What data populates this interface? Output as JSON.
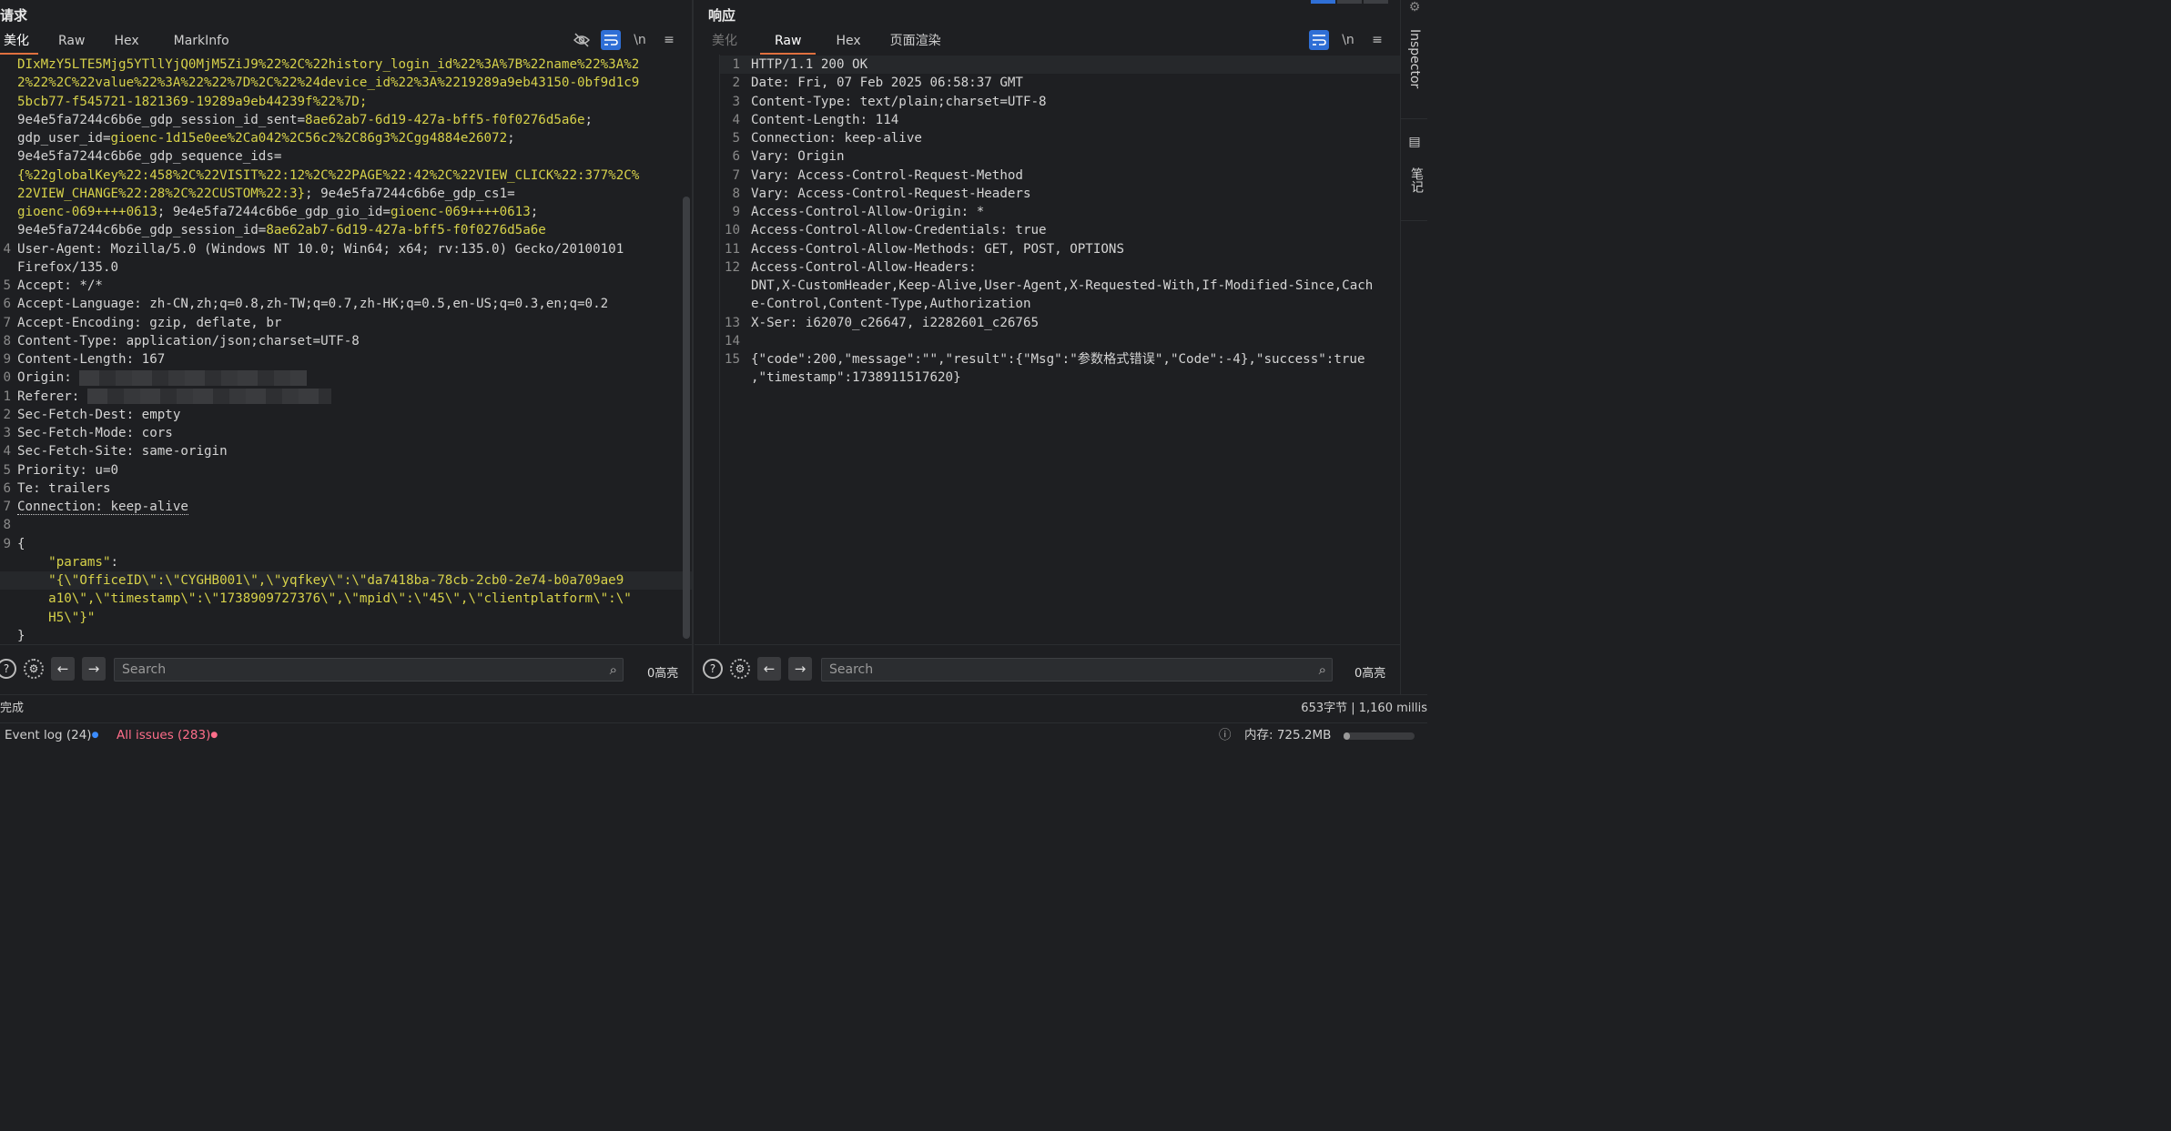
{
  "request": {
    "title": "请求",
    "tabs": [
      "美化",
      "Raw",
      "Hex",
      "MarkInfo"
    ],
    "lines": [
      {
        "n": "",
        "parts": [
          [
            "ck",
            "DIxMzY5LTE5Mjg5YTllYjQ0MjM5ZiJ9%22%2C%22history_login_id%22%3A%7B%22name%22%3A%2"
          ]
        ]
      },
      {
        "n": "",
        "parts": [
          [
            "ck",
            "2%22%2C%22value%22%3A%22%22%7D%2C%22%24device_id%22%3A%2219289a9eb43150-0bf9d1c9"
          ]
        ]
      },
      {
        "n": "",
        "parts": [
          [
            "ck",
            "5bcb77-f545721-1821369-19289a9eb44239f%22%7D;"
          ]
        ]
      },
      {
        "n": "",
        "parts": [
          [
            "hk",
            "9e4e5fa7244c6b6e_gdp_session_id_sent="
          ],
          [
            "ck",
            "8ae62ab7-6d19-427a-bff5-f0f0276d5a6e"
          ],
          [
            "hk",
            ";"
          ]
        ]
      },
      {
        "n": "",
        "parts": [
          [
            "hk",
            "gdp_user_id="
          ],
          [
            "ck",
            "gioenc-1d15e0ee%2Ca042%2C56c2%2C86g3%2Cgg4884e26072"
          ],
          [
            "hk",
            ";"
          ]
        ]
      },
      {
        "n": "",
        "parts": [
          [
            "hk",
            "9e4e5fa7244c6b6e_gdp_sequence_ids="
          ]
        ]
      },
      {
        "n": "",
        "parts": [
          [
            "ck",
            "{%22globalKey%22:458%2C%22VISIT%22:12%2C%22PAGE%22:42%2C%22VIEW_CLICK%22:377%2C%"
          ]
        ]
      },
      {
        "n": "",
        "parts": [
          [
            "ck",
            "22VIEW_CHANGE%22:28%2C%22CUSTOM%22:3}"
          ],
          [
            "hk",
            "; 9e4e5fa7244c6b6e_gdp_cs1="
          ]
        ]
      },
      {
        "n": "",
        "parts": [
          [
            "ck",
            "gioenc-069++++0613"
          ],
          [
            "hk",
            "; 9e4e5fa7244c6b6e_gdp_gio_id="
          ],
          [
            "ck",
            "gioenc-069++++0613"
          ],
          [
            "hk",
            ";"
          ]
        ]
      },
      {
        "n": "",
        "parts": [
          [
            "hk",
            "9e4e5fa7244c6b6e_gdp_session_id="
          ],
          [
            "ck",
            "8ae62ab7-6d19-427a-bff5-f0f0276d5a6e"
          ]
        ]
      },
      {
        "n": "4",
        "parts": [
          [
            "hk",
            "User-Agent"
          ],
          [
            "hv",
            ": Mozilla/5.0 (Windows NT 10.0; Win64; x64; rv:135.0) Gecko/20100101"
          ]
        ]
      },
      {
        "n": "",
        "parts": [
          [
            "hv",
            "Firefox/135.0"
          ]
        ]
      },
      {
        "n": "5",
        "parts": [
          [
            "hk",
            "Accept"
          ],
          [
            "hv",
            ": */*"
          ]
        ]
      },
      {
        "n": "6",
        "parts": [
          [
            "hk",
            "Accept-Language"
          ],
          [
            "hv",
            ": zh-CN,zh;q=0.8,zh-TW;q=0.7,zh-HK;q=0.5,en-US;q=0.3,en;q=0.2"
          ]
        ]
      },
      {
        "n": "7",
        "parts": [
          [
            "hk",
            "Accept-Encoding"
          ],
          [
            "hv",
            ": gzip, deflate, br"
          ]
        ]
      },
      {
        "n": "8",
        "parts": [
          [
            "hk",
            "Content-Type"
          ],
          [
            "hv",
            ": application/json;charset=UTF-8"
          ]
        ]
      },
      {
        "n": "9",
        "parts": [
          [
            "hk",
            "Content-Length"
          ],
          [
            "hv",
            ": 167"
          ]
        ]
      },
      {
        "n": "0",
        "parts": [
          [
            "hk",
            "Origin"
          ],
          [
            "hv",
            ": "
          ],
          [
            "blur",
            "250"
          ]
        ]
      },
      {
        "n": "1",
        "parts": [
          [
            "hk",
            "Referer"
          ],
          [
            "hv",
            ": "
          ],
          [
            "blur",
            "268"
          ]
        ]
      },
      {
        "n": "2",
        "parts": [
          [
            "hk",
            "Sec-Fetch-Dest"
          ],
          [
            "hv",
            ": empty"
          ]
        ]
      },
      {
        "n": "3",
        "parts": [
          [
            "hk",
            "Sec-Fetch-Mode"
          ],
          [
            "hv",
            ": cors"
          ]
        ]
      },
      {
        "n": "4",
        "parts": [
          [
            "hk",
            "Sec-Fetch-Site"
          ],
          [
            "hv",
            ": same-origin"
          ]
        ]
      },
      {
        "n": "5",
        "parts": [
          [
            "hk",
            "Priority"
          ],
          [
            "hv",
            ": u=0"
          ]
        ]
      },
      {
        "n": "6",
        "parts": [
          [
            "hk",
            "Te"
          ],
          [
            "hv",
            ": trailers"
          ]
        ]
      },
      {
        "n": "7",
        "parts": [
          [
            "hk",
            "Connection: keep-alive"
          ]
        ]
      },
      {
        "n": "8",
        "parts": []
      },
      {
        "n": "9",
        "parts": [
          [
            "hv",
            "{"
          ]
        ]
      },
      {
        "n": "",
        "parts": [
          [
            "hv",
            "    "
          ],
          [
            "jk",
            "\"params\""
          ],
          [
            "hv",
            ":"
          ]
        ]
      },
      {
        "n": "",
        "parts": [
          [
            "hv",
            "    "
          ],
          [
            "js",
            "\"{\\\"OfficeID\\\":\\\"CYGHB001\\\",\\\"yqfkey\\\":\\\"da7418ba-78cb-2cb0-2e74-b0a709ae9"
          ]
        ]
      },
      {
        "n": "",
        "parts": [
          [
            "hv",
            "    "
          ],
          [
            "js",
            "a10\\\",\\\"timestamp\\\":\\\"1738909727376\\\",\\\"mpid\\\":\\\"45\\\",\\\"clientplatform\\\":\\\""
          ]
        ]
      },
      {
        "n": "",
        "parts": [
          [
            "hv",
            "    "
          ],
          [
            "js",
            "H5\\\"}\""
          ]
        ]
      },
      {
        "n": "",
        "parts": [
          [
            "hv",
            "}"
          ]
        ]
      }
    ],
    "search_placeholder": "Search",
    "highlights": "0高亮"
  },
  "response": {
    "title": "响应",
    "tabs": [
      "美化",
      "Raw",
      "Hex",
      "页面渲染"
    ],
    "lines": [
      {
        "n": "1",
        "parts": [
          [
            "hk",
            "HTTP/1.1 200 OK"
          ]
        ]
      },
      {
        "n": "2",
        "parts": [
          [
            "hk",
            "Date"
          ],
          [
            "hv",
            ": Fri, 07 Feb 2025 06:58:37 GMT"
          ]
        ]
      },
      {
        "n": "3",
        "parts": [
          [
            "hk",
            "Content-Type"
          ],
          [
            "hv",
            ": text/plain;charset=UTF-8"
          ]
        ]
      },
      {
        "n": "4",
        "parts": [
          [
            "hk",
            "Content-Length"
          ],
          [
            "hv",
            ": 114"
          ]
        ]
      },
      {
        "n": "5",
        "parts": [
          [
            "hk",
            "Connection"
          ],
          [
            "hv",
            ": keep-alive"
          ]
        ]
      },
      {
        "n": "6",
        "parts": [
          [
            "hk",
            "Vary"
          ],
          [
            "hv",
            ": Origin"
          ]
        ]
      },
      {
        "n": "7",
        "parts": [
          [
            "hk",
            "Vary"
          ],
          [
            "hv",
            ": Access-Control-Request-Method"
          ]
        ]
      },
      {
        "n": "8",
        "parts": [
          [
            "hk",
            "Vary"
          ],
          [
            "hv",
            ": Access-Control-Request-Headers"
          ]
        ]
      },
      {
        "n": "9",
        "parts": [
          [
            "hk",
            "Access-Control-Allow-Origin"
          ],
          [
            "hv",
            ": *"
          ]
        ]
      },
      {
        "n": "10",
        "parts": [
          [
            "hk",
            "Access-Control-Allow-Credentials"
          ],
          [
            "hv",
            ": true"
          ]
        ]
      },
      {
        "n": "11",
        "parts": [
          [
            "hk",
            "Access-Control-Allow-Methods"
          ],
          [
            "hv",
            ": GET, POST, OPTIONS"
          ]
        ]
      },
      {
        "n": "12",
        "parts": [
          [
            "hk",
            "Access-Control-Allow-Headers"
          ],
          [
            "hv",
            ":"
          ]
        ]
      },
      {
        "n": "",
        "parts": [
          [
            "hv",
            "DNT,X-CustomHeader,Keep-Alive,User-Agent,X-Requested-With,If-Modified-Since,Cach"
          ]
        ]
      },
      {
        "n": "",
        "parts": [
          [
            "hv",
            "e-Control,Content-Type,Authorization"
          ]
        ]
      },
      {
        "n": "13",
        "parts": [
          [
            "hk",
            "X-Ser"
          ],
          [
            "hv",
            ": i62070_c26647, i2282601_c26765"
          ]
        ]
      },
      {
        "n": "14",
        "parts": []
      },
      {
        "n": "15",
        "parts": [
          [
            "hv",
            "{\"code\":200,\"message\":\"\",\"result\":{\"Msg\":\"参数格式错误\",\"Code\":-4},\"success\":true"
          ]
        ]
      },
      {
        "n": "",
        "parts": [
          [
            "hv",
            ",\"timestamp\":1738911517620}"
          ]
        ]
      }
    ],
    "search_placeholder": "Search",
    "highlights": "0高亮"
  },
  "status": {
    "left": "完成",
    "right": "653字节 | 1,160 millis"
  },
  "footer": {
    "event_log": "Event log (24)",
    "issues": "All issues (283)",
    "memory": "内存: 725.2MB"
  },
  "sidebar": {
    "inspector": "Inspector",
    "notes": "笔记"
  },
  "icons": {
    "hide": "eye-slash-icon",
    "wrap": "wrap-icon",
    "newline": "\\n",
    "menu": "≡"
  }
}
